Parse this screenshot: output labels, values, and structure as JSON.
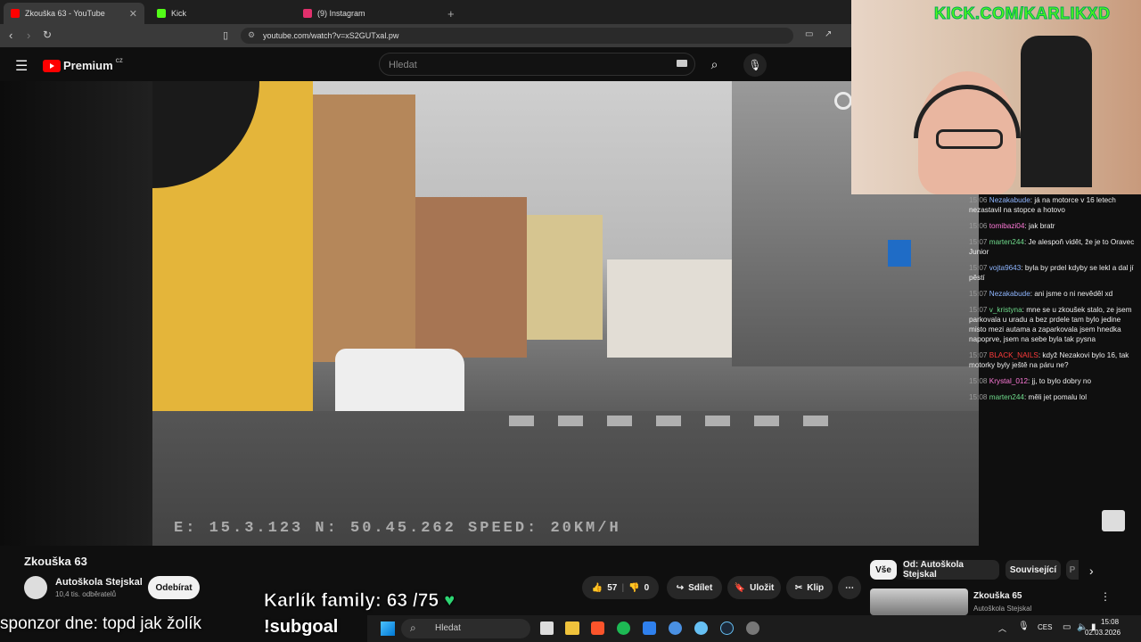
{
  "tabs": [
    {
      "label": "Zkouška 63 - YouTube",
      "active": true,
      "color": "#ff0000"
    },
    {
      "label": "Kick",
      "active": false,
      "color": "#53fc18"
    },
    {
      "label": "(9) Instagram",
      "active": false,
      "color": "#e1306c"
    }
  ],
  "address": {
    "url": "youtube.com/watch?v=xS2GUTxal.pw"
  },
  "youtube": {
    "logo": "Premium",
    "region": "CZ",
    "search_placeholder": "Hledat",
    "video_overlay": "E: 15.3.123  N: 50.45.262 SPEED: 20KM/H",
    "title": "Zkouška 63",
    "channel": "Autoškola Stejskal",
    "subscribers": "10,4 tis. odběratelů",
    "subscribe": "Odebírat",
    "likes": "57",
    "dislikes": "0",
    "share": "Sdílet",
    "save": "Uložit",
    "clip": "Klip",
    "chips": [
      "Vše",
      "Od: Autoškola Stejskal",
      "Související",
      "P"
    ],
    "next": {
      "title": "Zkouška 65",
      "channel": "Autoškola Stejskal"
    }
  },
  "stream": {
    "kick_label": "KICK.COM/KARLIKXD",
    "family": "Karlík family: 63 /75",
    "subgoal": "!subgoal",
    "sponsor": "sponzor dne: topd jak žolík"
  },
  "chat": [
    {
      "time": "15:06",
      "user": "Nezakabude",
      "color": "#8fb6ff",
      "text": "já na motorce v 16 letech nezastavil na stopce a hotovo"
    },
    {
      "time": "15:06",
      "user": "tomibazi04",
      "color": "#ff7ad9",
      "text": "jak bratr"
    },
    {
      "time": "15:07",
      "user": "marten244",
      "color": "#6fdc8c",
      "text": "Je alespoň vidět, že je to Oravec Junior"
    },
    {
      "time": "15:07",
      "user": "vojta9643",
      "color": "#8fb6ff",
      "text": "byla by prdel kdyby se lekl a dal jí pěstí"
    },
    {
      "time": "15:07",
      "user": "Nezakabude",
      "color": "#8fb6ff",
      "text": "ani jsme o ni nevěděl xd"
    },
    {
      "time": "15:07",
      "user": "v_kristyna",
      "color": "#6fdc8c",
      "text": "mne se u zkoušek stalo, ze jsem parkovala u uradu a bez prdele tam bylo jedine misto mezi autama a zaparkovala jsem hnedka napoprve, jsem na sebe byla tak pysna"
    },
    {
      "time": "15:07",
      "user": "BLACK_NAILS",
      "color": "#ff3b3b",
      "text": "když Nezakovi bylo 16, tak motorky byly ještě na páru ne?"
    },
    {
      "time": "15:08",
      "user": "Krystal_012",
      "color": "#ff7ad9",
      "text": "jj, to bylo dobry no"
    },
    {
      "time": "15:08",
      "user": "marten244",
      "color": "#6fdc8c",
      "text": "měli jet pomalu lol"
    }
  ],
  "taskbar": {
    "search": "Hledat",
    "lang": "CES",
    "time": "15:08",
    "date": "02.03.2026"
  }
}
